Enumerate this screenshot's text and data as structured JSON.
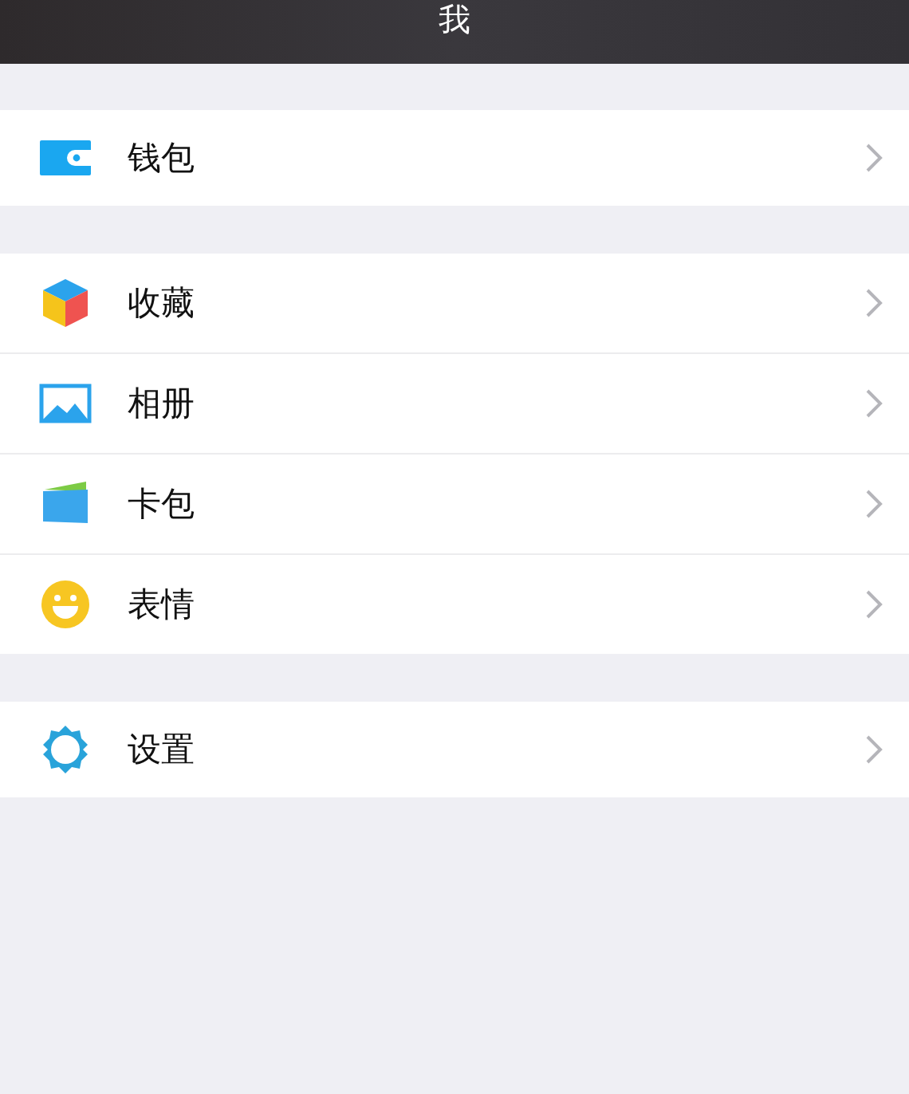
{
  "header": {
    "title": "我"
  },
  "groups": [
    {
      "items": [
        {
          "label": "钱包",
          "kind": "wallet"
        }
      ]
    },
    {
      "items": [
        {
          "label": "收藏",
          "kind": "cube"
        },
        {
          "label": "相册",
          "kind": "photo"
        },
        {
          "label": "卡包",
          "kind": "card"
        },
        {
          "label": "表情",
          "kind": "smile"
        }
      ]
    },
    {
      "items": [
        {
          "label": "设置",
          "kind": "gear"
        }
      ]
    }
  ]
}
